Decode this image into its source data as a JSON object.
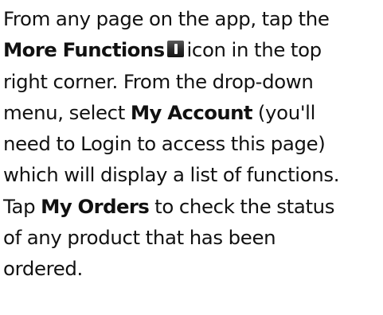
{
  "instructions": {
    "line1": "From any page on the app, tap the",
    "more_functions_label": "More Functions",
    "more_functions_icon": "more-functions-icon",
    "line2_tail": "icon in the top",
    "line3": "right corner. From the drop-down",
    "line4_head": "menu, select",
    "my_account_label": "My Account",
    "line4_tail": "(you'll",
    "line5": "need to Login to access this page)",
    "line6": "which will display a list of functions.",
    "line7_head": "Tap",
    "my_orders_label": "My Orders",
    "line7_tail": "to check the status",
    "line8": "of any product that has been",
    "line9": "ordered."
  }
}
